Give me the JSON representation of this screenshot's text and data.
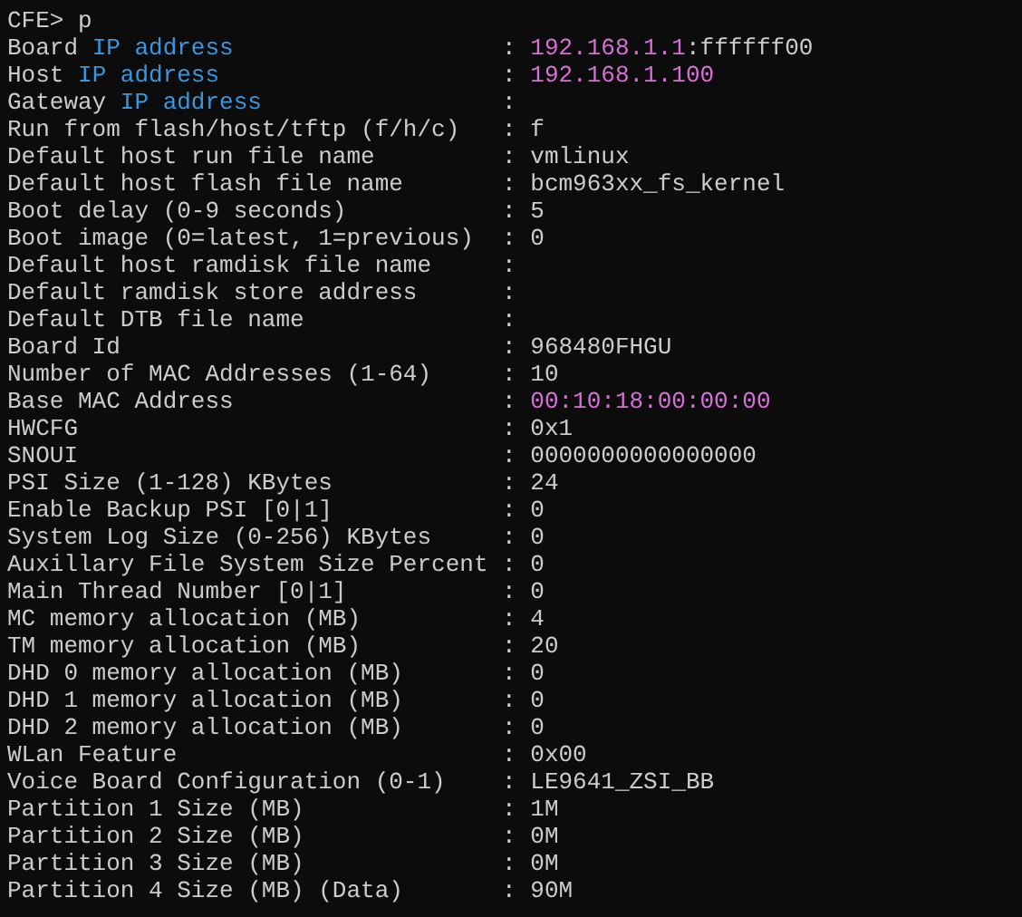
{
  "terminal": {
    "prompt": {
      "text": "CFE> p"
    },
    "lines": [
      {
        "label": [
          {
            "text": "Board "
          },
          {
            "text": "IP address",
            "kind": "keyword"
          }
        ],
        "separator": ":",
        "value": [
          {
            "text": "192.168.1.1",
            "kind": "address"
          },
          {
            "text": ":ffffff00"
          }
        ]
      },
      {
        "label": [
          {
            "text": "Host "
          },
          {
            "text": "IP address",
            "kind": "keyword"
          }
        ],
        "separator": ":",
        "value": [
          {
            "text": "192.168.1.100",
            "kind": "address"
          }
        ]
      },
      {
        "label": [
          {
            "text": "Gateway "
          },
          {
            "text": "IP address",
            "kind": "keyword"
          }
        ],
        "separator": ":"
      },
      {
        "label": [
          {
            "text": "Run from flash/host/tftp (f/h/c)"
          }
        ],
        "separator": ":",
        "value": [
          {
            "text": "f"
          }
        ]
      },
      {
        "label": [
          {
            "text": "Default host run file name"
          }
        ],
        "separator": ":",
        "value": [
          {
            "text": "vmlinux"
          }
        ]
      },
      {
        "label": [
          {
            "text": "Default host flash file name"
          }
        ],
        "separator": ":",
        "value": [
          {
            "text": "bcm963xx_fs_kernel"
          }
        ]
      },
      {
        "label": [
          {
            "text": "Boot delay (0-9 seconds)"
          }
        ],
        "separator": ":",
        "value": [
          {
            "text": "5"
          }
        ]
      },
      {
        "label": [
          {
            "text": "Boot image (0=latest, 1=previous)"
          }
        ],
        "separator": ":",
        "value": [
          {
            "text": "0"
          }
        ]
      },
      {
        "label": [
          {
            "text": "Default host ramdisk file name"
          }
        ],
        "separator": ":"
      },
      {
        "label": [
          {
            "text": "Default ramdisk store address"
          }
        ],
        "separator": ":"
      },
      {
        "label": [
          {
            "text": "Default DTB file name"
          }
        ],
        "separator": ":"
      },
      {
        "label": [
          {
            "text": "Board Id"
          }
        ],
        "separator": ":",
        "value": [
          {
            "text": "968480FHGU"
          }
        ]
      },
      {
        "label": [
          {
            "text": "Number of MAC Addresses (1-64)"
          }
        ],
        "separator": ":",
        "value": [
          {
            "text": "10"
          }
        ]
      },
      {
        "label": [
          {
            "text": "Base MAC Address"
          }
        ],
        "separator": ":",
        "value": [
          {
            "text": "00:10:18:00:00:00",
            "kind": "address"
          }
        ]
      },
      {
        "label": [
          {
            "text": "HWCFG"
          }
        ],
        "separator": ":",
        "value": [
          {
            "text": "0x1"
          }
        ]
      },
      {
        "label": [
          {
            "text": "SNOUI"
          }
        ],
        "separator": ":",
        "value": [
          {
            "text": "0000000000000000"
          }
        ]
      },
      {
        "label": [
          {
            "text": "PSI Size (1-128) KBytes"
          }
        ],
        "separator": ":",
        "value": [
          {
            "text": "24"
          }
        ]
      },
      {
        "label": [
          {
            "text": "Enable Backup PSI [0|1]"
          }
        ],
        "separator": ":",
        "value": [
          {
            "text": "0"
          }
        ]
      },
      {
        "label": [
          {
            "text": "System Log Size (0-256) KBytes"
          }
        ],
        "separator": ":",
        "value": [
          {
            "text": "0"
          }
        ]
      },
      {
        "label": [
          {
            "text": "Auxillary File System Size Percent"
          }
        ],
        "separator": ":",
        "value": [
          {
            "text": "0"
          }
        ]
      },
      {
        "label": [
          {
            "text": "Main Thread Number [0|1]"
          }
        ],
        "separator": ":",
        "value": [
          {
            "text": "0"
          }
        ]
      },
      {
        "label": [
          {
            "text": "MC memory allocation (MB)"
          }
        ],
        "separator": ":",
        "value": [
          {
            "text": "4"
          }
        ]
      },
      {
        "label": [
          {
            "text": "TM memory allocation (MB)"
          }
        ],
        "separator": ":",
        "value": [
          {
            "text": "20"
          }
        ]
      },
      {
        "label": [
          {
            "text": "DHD 0 memory allocation (MB)"
          }
        ],
        "separator": ":",
        "value": [
          {
            "text": "0"
          }
        ]
      },
      {
        "label": [
          {
            "text": "DHD 1 memory allocation (MB)"
          }
        ],
        "separator": ":",
        "value": [
          {
            "text": "0"
          }
        ]
      },
      {
        "label": [
          {
            "text": "DHD 2 memory allocation (MB)"
          }
        ],
        "separator": ":",
        "value": [
          {
            "text": "0"
          }
        ]
      },
      {
        "label": [
          {
            "text": "WLan Feature"
          }
        ],
        "separator": ":",
        "value": [
          {
            "text": "0x00"
          }
        ]
      },
      {
        "label": [
          {
            "text": "Voice Board Configuration (0-1)"
          }
        ],
        "separator": ":",
        "value": [
          {
            "text": "LE9641_ZSI_BB"
          }
        ]
      },
      {
        "label": [
          {
            "text": "Partition 1 Size (MB)"
          }
        ],
        "separator": ":",
        "value": [
          {
            "text": "1M"
          }
        ]
      },
      {
        "label": [
          {
            "text": "Partition 2 Size (MB)"
          }
        ],
        "separator": ":",
        "value": [
          {
            "text": "0M"
          }
        ]
      },
      {
        "label": [
          {
            "text": "Partition 3 Size (MB)"
          }
        ],
        "separator": ":",
        "value": [
          {
            "text": "0M"
          }
        ]
      },
      {
        "label": [
          {
            "text": "Partition 4 Size (MB) (Data)"
          }
        ],
        "separator": ":",
        "value": [
          {
            "text": "90M"
          }
        ]
      }
    ]
  }
}
